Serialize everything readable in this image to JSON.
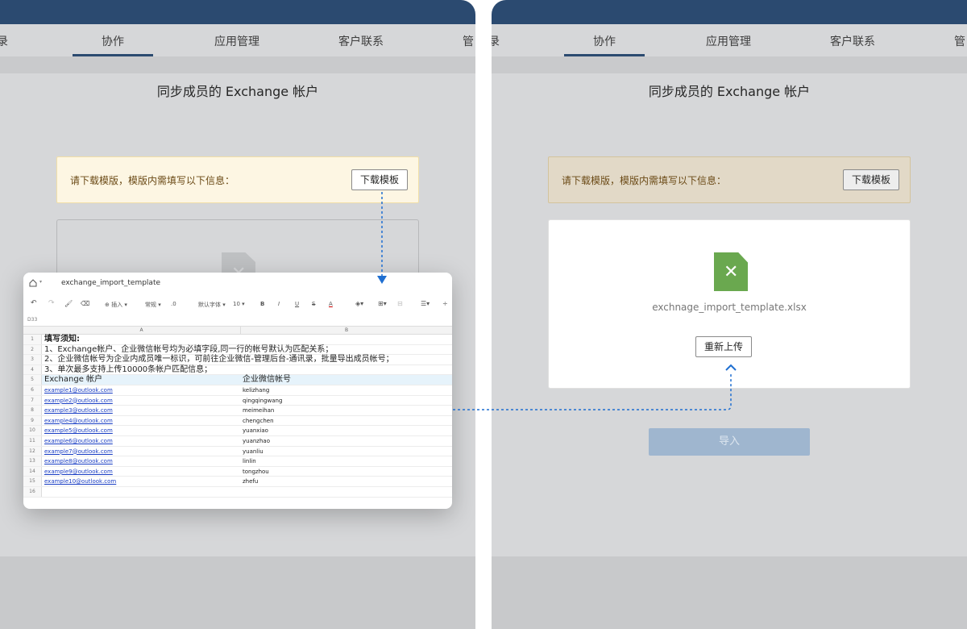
{
  "tabs": {
    "left_partial": "录",
    "collab": "协作",
    "app_mgmt": "应用管理",
    "customer": "客户联系",
    "right_partial": "管"
  },
  "page_title": "同步成员的 Exchange 帐户",
  "notice": {
    "text": "请下载模版，模版内需填写以下信息：",
    "download_button": "下载模板"
  },
  "spreadsheet": {
    "title": "exchange_import_template",
    "cell_ref": "D33",
    "toolbar": {
      "insert": "插入",
      "format": "常规",
      "decimal": ".0",
      "font": "默认字体",
      "size": "10",
      "bold": "B",
      "italic": "I",
      "underline": "U",
      "strike": "S",
      "font_color": "A"
    },
    "columns": [
      "A",
      "B"
    ],
    "rows": [
      {
        "n": "1",
        "a": "填写须知:",
        "b": "",
        "style": "heading"
      },
      {
        "n": "2",
        "a": "1、Exchange帐户、企业微信帐号均为必填字段,同一行的帐号默认为匹配关系；",
        "b": "",
        "style": "note"
      },
      {
        "n": "3",
        "a": "2、企业微信帐号为企业内成员唯一标识，可前往企业微信-管理后台-通讯录，批量导出成员帐号；",
        "b": "",
        "style": "note"
      },
      {
        "n": "4",
        "a": "3、单次最多支持上传10000条帐户匹配信息；",
        "b": "",
        "style": "note"
      },
      {
        "n": "5",
        "a": "Exchange 帐户",
        "b": "企业微信帐号",
        "style": "header"
      },
      {
        "n": "6",
        "a": "example1@outlook.com",
        "b": "kelizhang",
        "style": "data"
      },
      {
        "n": "7",
        "a": "example2@outlook.com",
        "b": "qingqingwang",
        "style": "data"
      },
      {
        "n": "8",
        "a": "example3@outlook.com",
        "b": "meimeihan",
        "style": "data"
      },
      {
        "n": "9",
        "a": "example4@outlook.com",
        "b": "chengchen",
        "style": "data"
      },
      {
        "n": "10",
        "a": "example5@outlook.com",
        "b": "yuanxiao",
        "style": "data"
      },
      {
        "n": "11",
        "a": "example6@outlook.com",
        "b": "yuanzhao",
        "style": "data"
      },
      {
        "n": "12",
        "a": "example7@outlook.com",
        "b": "yuanliu",
        "style": "data"
      },
      {
        "n": "13",
        "a": "example8@outlook.com",
        "b": "linlin",
        "style": "data"
      },
      {
        "n": "14",
        "a": "example9@outlook.com",
        "b": "tongzhou",
        "style": "data"
      },
      {
        "n": "15",
        "a": "example10@outlook.com",
        "b": "zhefu",
        "style": "data"
      },
      {
        "n": "16",
        "a": "",
        "b": "",
        "style": "data"
      }
    ]
  },
  "upload": {
    "filename": "exchnage_import_template.xlsx",
    "reupload_button": "重新上传",
    "import_button": "导入"
  },
  "colors": {
    "topbar": "#2b4a70",
    "notice_bg": "#fdf6e3",
    "file_green": "#6aa84f",
    "arrow": "#1f6fd1"
  },
  "icons": {
    "file": "xlsx-file-icon",
    "home": "home-icon",
    "undo": "undo-icon",
    "redo": "redo-icon"
  }
}
